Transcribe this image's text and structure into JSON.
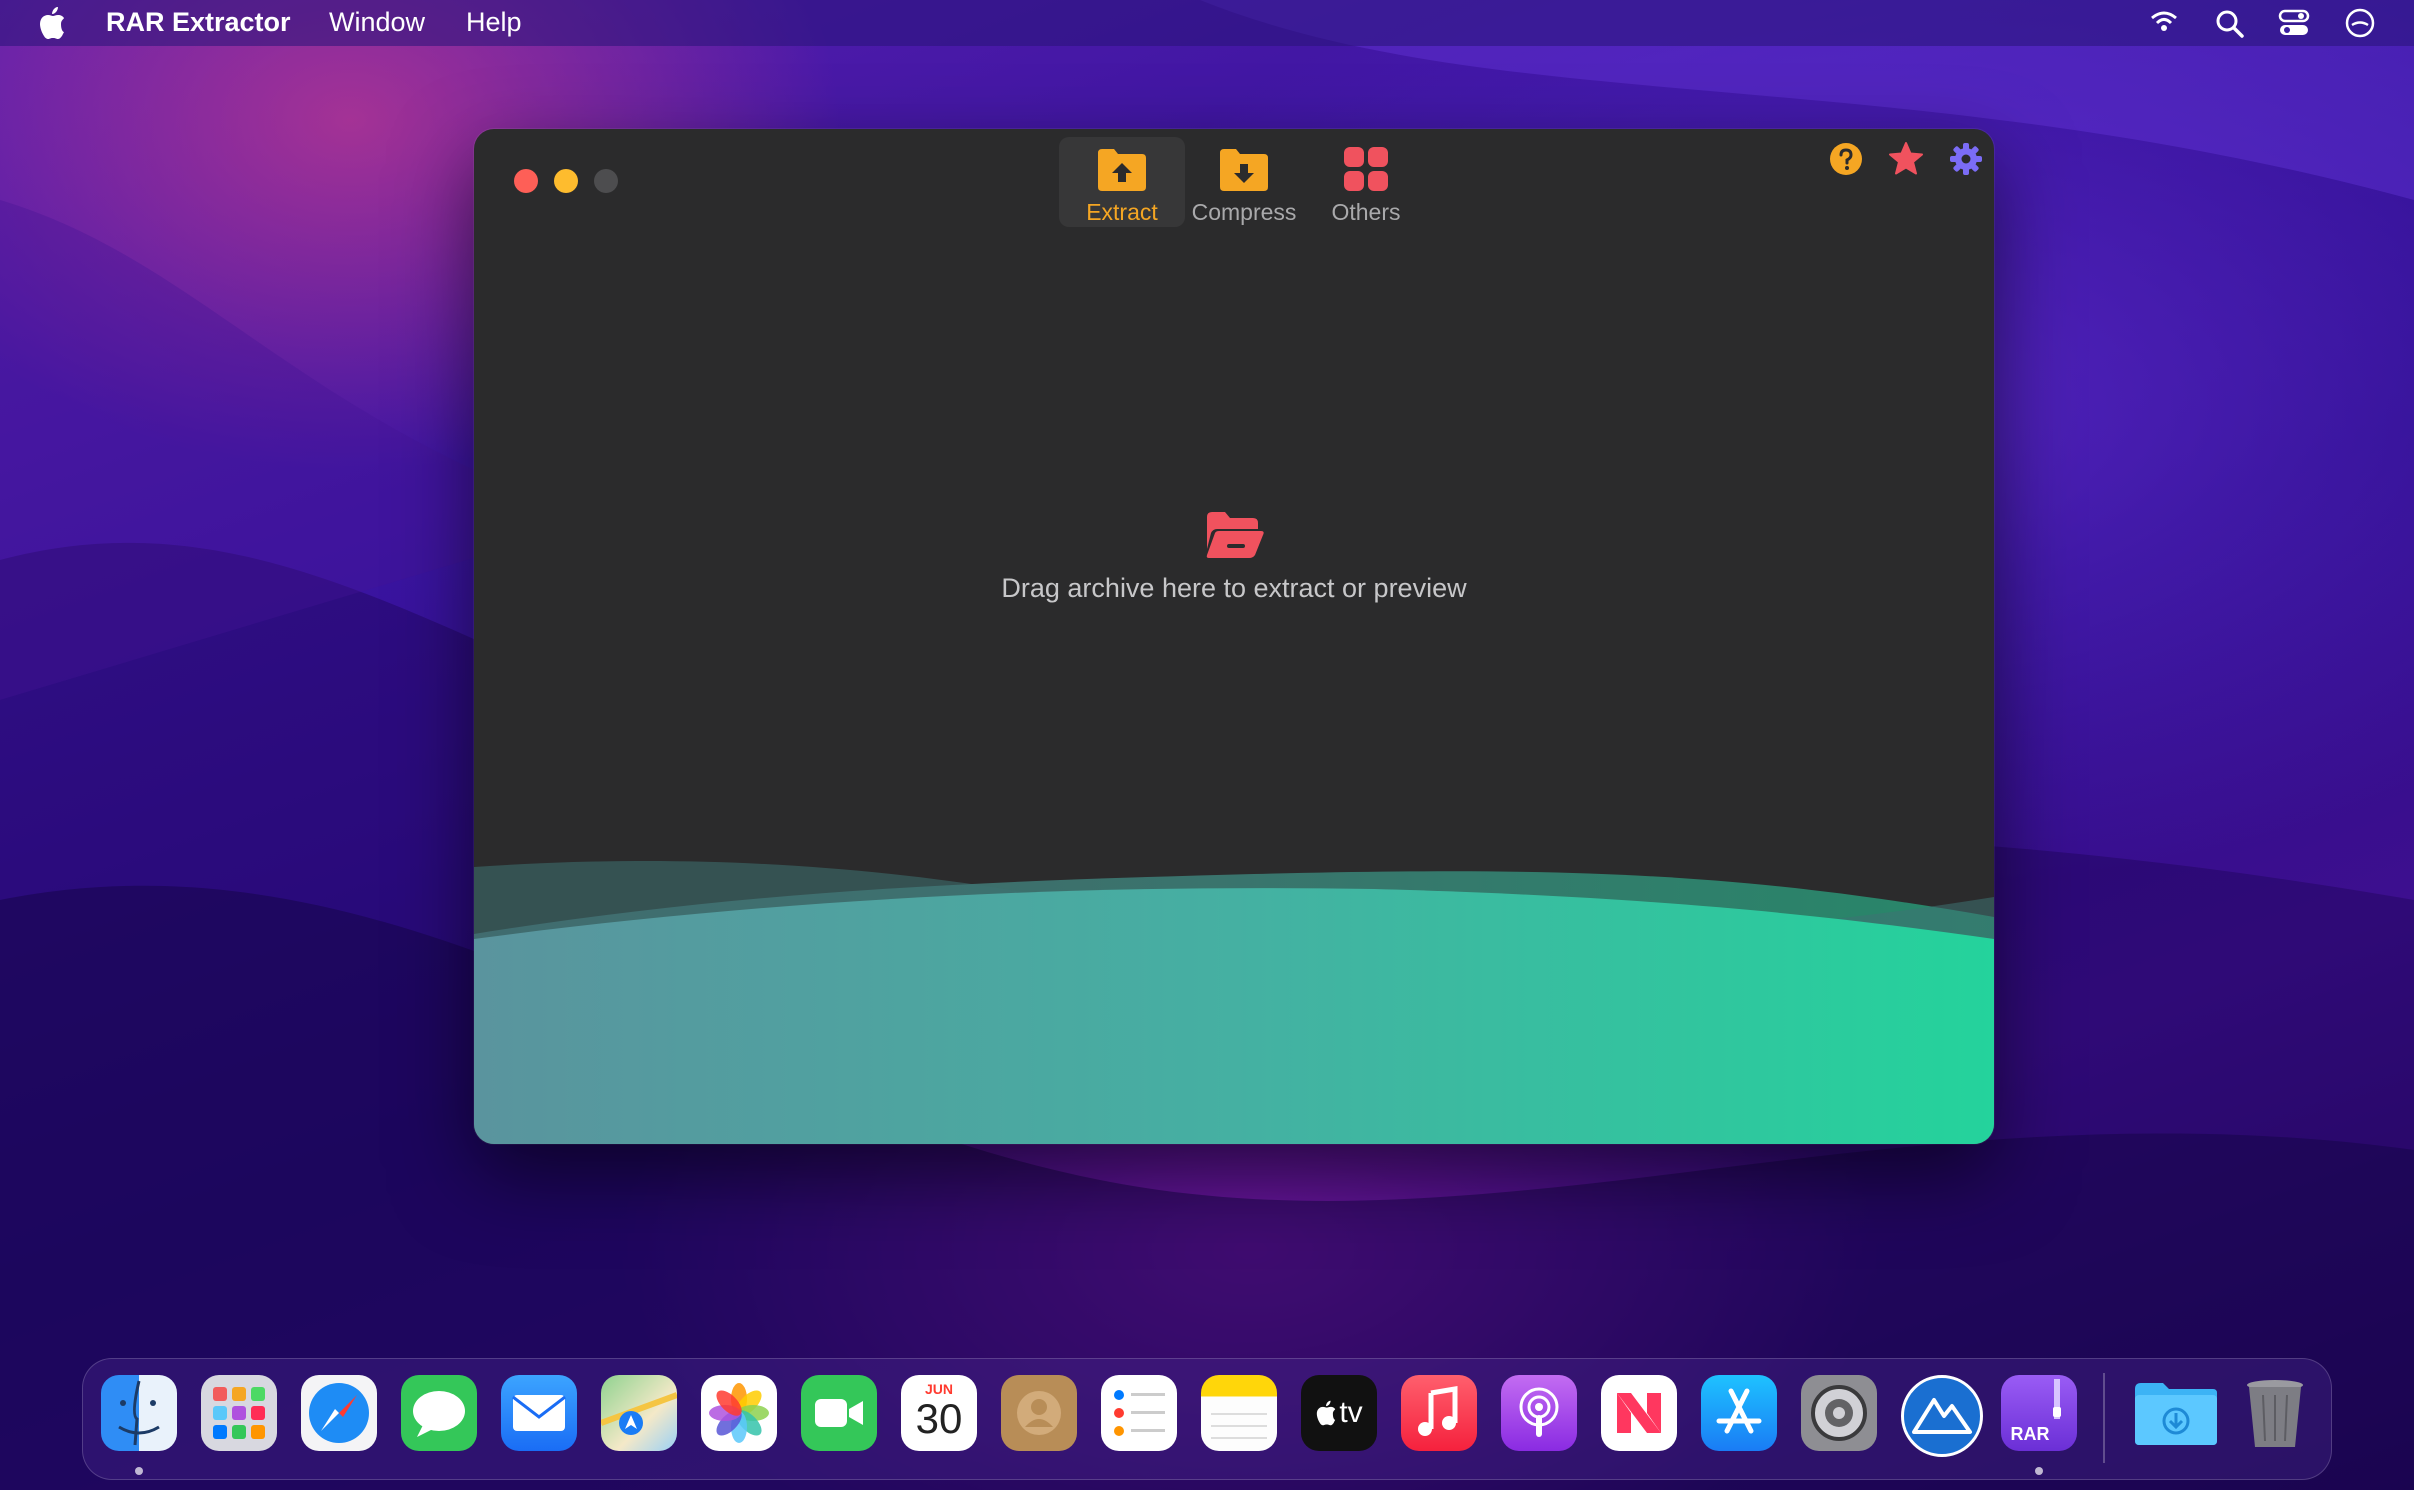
{
  "menubar": {
    "app_name": "RAR Extractor",
    "menus": [
      "Window",
      "Help"
    ],
    "status_icons": [
      "wifi-icon",
      "spotlight-search-icon",
      "control-center-icon",
      "user-icon"
    ]
  },
  "window": {
    "tabs": [
      {
        "label": "Extract",
        "icon": "folder-upload-icon",
        "active": true
      },
      {
        "label": "Compress",
        "icon": "folder-download-icon",
        "active": false
      },
      {
        "label": "Others",
        "icon": "grid-icon",
        "active": false
      }
    ],
    "corner_buttons": [
      "help-icon",
      "star-icon",
      "settings-icon"
    ],
    "drop_text": "Drag archive here to extract or preview",
    "colors": {
      "accent": "#f5a623",
      "drop_icon": "#f0525e",
      "wave_start": "#5a949e",
      "wave_end": "#24d39c"
    }
  },
  "dock": {
    "apps": [
      "Finder",
      "Launchpad",
      "Safari",
      "Messages",
      "Mail",
      "Maps",
      "Photos",
      "FaceTime",
      "Calendar",
      "Contacts",
      "Reminders",
      "Notes",
      "TV",
      "Music",
      "Podcasts",
      "News",
      "App Store",
      "System Preferences",
      "Mountain Duck",
      "RAR Extractor",
      "Downloads",
      "Trash"
    ],
    "calendar_month": "JUN",
    "calendar_day": "30",
    "tv_label": "tv",
    "rar_label": "RAR"
  }
}
